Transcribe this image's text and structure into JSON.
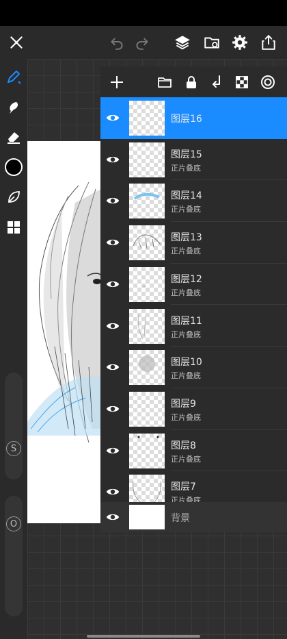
{
  "colors": {
    "accent": "#1a8cff",
    "topbar": "#2a2a2a",
    "panel": "#2b2b2b",
    "canvas_bg": "#2f2f2f"
  },
  "topbar": {
    "icons": [
      "close-icon",
      "undo-icon",
      "redo-icon",
      "layers-icon",
      "import-icon",
      "settings-icon",
      "share-icon"
    ]
  },
  "sidebar": {
    "tools": [
      "brush-icon",
      "smudge-icon",
      "eraser-icon",
      "color-swatch",
      "leaf-icon",
      "grid-icon"
    ],
    "size_slider_label": "S",
    "opacity_slider_label": "O"
  },
  "layers_panel": {
    "toolbar_icons": [
      "add-layer-icon",
      "folder-icon",
      "lock-icon",
      "merge-down-icon",
      "checkerboard-icon",
      "reference-icon"
    ],
    "layers": [
      {
        "name": "图层16",
        "mode": "",
        "selected": true
      },
      {
        "name": "图层15",
        "mode": "正片叠底",
        "selected": false
      },
      {
        "name": "图层14",
        "mode": "正片叠底",
        "selected": false
      },
      {
        "name": "图层13",
        "mode": "正片叠底",
        "selected": false
      },
      {
        "name": "图层12",
        "mode": "正片叠底",
        "selected": false
      },
      {
        "name": "图层11",
        "mode": "正片叠底",
        "selected": false
      },
      {
        "name": "图层10",
        "mode": "正片叠底",
        "selected": false
      },
      {
        "name": "图层9",
        "mode": "正片叠底",
        "selected": false
      },
      {
        "name": "图层8",
        "mode": "正片叠底",
        "selected": false
      },
      {
        "name": "图层7",
        "mode": "正片叠底",
        "selected": false
      }
    ],
    "background_layer": {
      "name": "背景"
    }
  }
}
